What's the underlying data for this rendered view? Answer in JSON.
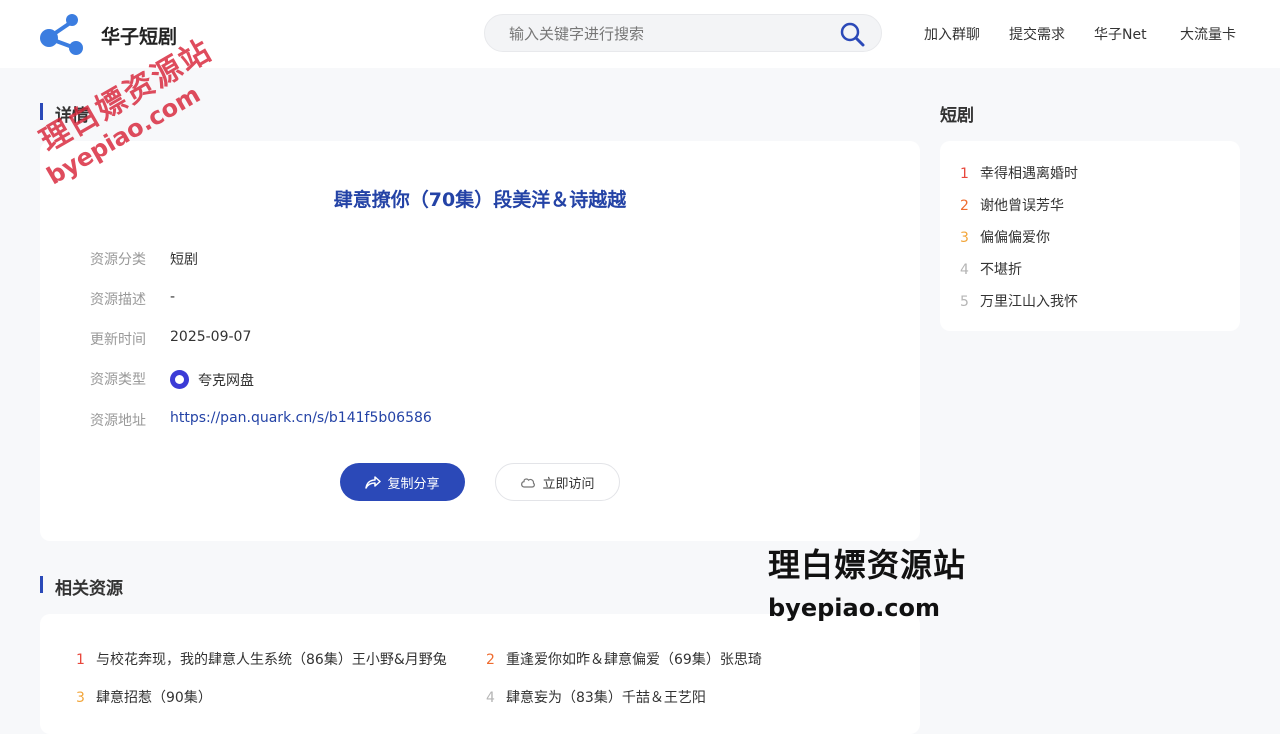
{
  "header": {
    "site_name": "华子短剧",
    "search_placeholder": "输入关键字进行搜索",
    "nav": [
      "加入群聊",
      "提交需求",
      "华子Net",
      "大流量卡"
    ]
  },
  "detail": {
    "section_title": "详情",
    "title": "肆意撩你（70集）段美洋＆诗越越",
    "fields": [
      {
        "label": "资源分类",
        "value": "短剧"
      },
      {
        "label": "资源描述",
        "value": "-"
      },
      {
        "label": "更新时间",
        "value": "2025-09-07"
      },
      {
        "label": "资源类型",
        "value": "夸克网盘"
      },
      {
        "label": "资源地址",
        "value": "https://pan.quark.cn/s/b141f5b06586"
      }
    ],
    "copy_button": "复制分享",
    "visit_button": "立即访问"
  },
  "sidebar": {
    "title": "短剧",
    "items": [
      {
        "rank": "1",
        "title": "幸得相遇离婚时"
      },
      {
        "rank": "2",
        "title": "谢他曾误芳华"
      },
      {
        "rank": "3",
        "title": "偏偏偏爱你"
      },
      {
        "rank": "4",
        "title": "不堪折"
      },
      {
        "rank": "5",
        "title": "万里江山入我怀"
      }
    ]
  },
  "related": {
    "title": "相关资源",
    "items": [
      {
        "rank": "1",
        "title": "与校花奔现，我的肆意人生系统（86集）王小野&月野兔"
      },
      {
        "rank": "2",
        "title": "重逢爱你如昨＆肆意偏爱（69集）张思琦"
      },
      {
        "rank": "3",
        "title": "肆意招惹（90集）"
      },
      {
        "rank": "4",
        "title": "肆意妄为（83集）千喆＆王艺阳"
      }
    ]
  },
  "watermarks": {
    "top_line1": "理白嫖资源站",
    "top_line2": "byepiao.com",
    "bottom_line1": "理白嫖资源站",
    "bottom_line2": "byepiao.com"
  },
  "colors": {
    "accent": "#2b49b8",
    "rank1": "#e8473c",
    "rank2": "#ef6b2e",
    "rank3": "#f2a63b",
    "rank_other": "#b5b5b5",
    "watermark_red": "#d8263a"
  }
}
